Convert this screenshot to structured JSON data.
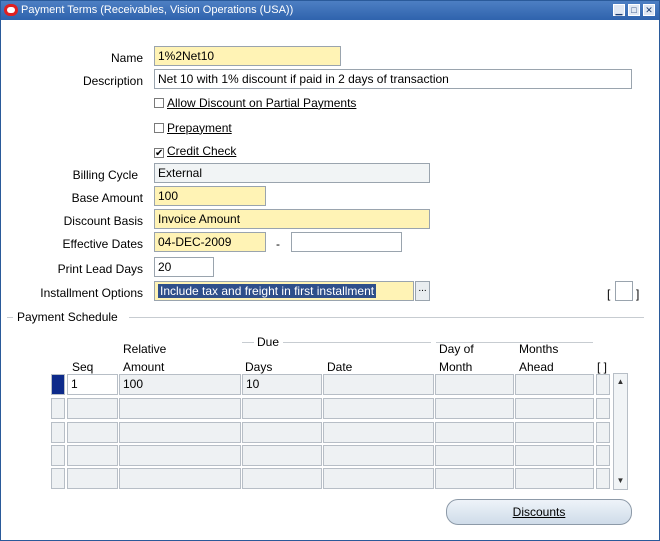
{
  "window": {
    "title": "Payment Terms (Receivables, Vision Operations (USA))",
    "minimize": "▁",
    "maximize": "□",
    "close": "✕"
  },
  "form": {
    "name_label": "Name",
    "name_value": "1%2Net10",
    "description_label": "Description",
    "description_value": "Net 10 with 1% discount if paid in 2 days of transaction",
    "allow_discount_label": "Allow Discount on Partial Payments",
    "allow_discount_checked": false,
    "prepayment_label": "Prepayment",
    "prepayment_checked": false,
    "credit_check_label": "Credit Check",
    "credit_check_checked": true,
    "billing_cycle_label": "Billing Cycle",
    "billing_cycle_value": "External",
    "base_amount_label": "Base Amount",
    "base_amount_value": "100",
    "discount_basis_label": "Discount Basis",
    "discount_basis_value": "Invoice Amount",
    "effective_dates_label": "Effective Dates",
    "effective_from": "04-DEC-2009",
    "date_separator": "-",
    "effective_to": "",
    "print_lead_days_label": "Print Lead Days",
    "print_lead_days_value": "20",
    "installment_options_label": "Installment Options",
    "installment_options_value": "Include tax and freight in first installment",
    "lov_button": "...",
    "bracket_open": "[",
    "bracket_close": "]"
  },
  "schedule": {
    "title": "Payment Schedule",
    "due_group": "Due",
    "headers": {
      "seq": "Seq",
      "relative_amount_1": "Relative",
      "relative_amount_2": "Amount",
      "days": "Days",
      "date": "Date",
      "day_of_month_1": "Day of",
      "day_of_month_2": "Month",
      "months_ahead_1": "Months",
      "months_ahead_2": "Ahead",
      "flex": "[ ]"
    },
    "rows": [
      {
        "seq": "1",
        "amount": "100",
        "days": "10",
        "date": "",
        "day_of_month": "",
        "months_ahead": ""
      },
      {
        "seq": "",
        "amount": "",
        "days": "",
        "date": "",
        "day_of_month": "",
        "months_ahead": ""
      },
      {
        "seq": "",
        "amount": "",
        "days": "",
        "date": "",
        "day_of_month": "",
        "months_ahead": ""
      },
      {
        "seq": "",
        "amount": "",
        "days": "",
        "date": "",
        "day_of_month": "",
        "months_ahead": ""
      },
      {
        "seq": "",
        "amount": "",
        "days": "",
        "date": "",
        "day_of_month": "",
        "months_ahead": ""
      }
    ],
    "scroll_up": "▲",
    "scroll_down": "▼"
  },
  "buttons": {
    "discounts": "Discounts"
  }
}
